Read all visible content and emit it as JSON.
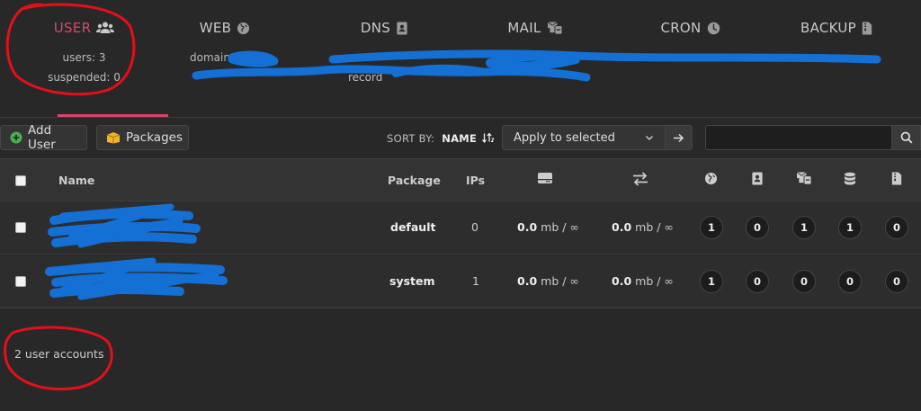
{
  "tabs": [
    {
      "id": "user",
      "label": "USER",
      "icon": "users-icon",
      "stat1": "users: 3",
      "stat2": "suspended: 0",
      "active": true
    },
    {
      "id": "web",
      "label": "WEB",
      "icon": "globe-icon",
      "stat1": "domains",
      "stat2": ""
    },
    {
      "id": "dns",
      "label": "DNS",
      "icon": "address-book-icon",
      "stat1": "",
      "stat2": "record"
    },
    {
      "id": "mail",
      "label": "MAIL",
      "icon": "mail-bulk-icon",
      "stat1": "",
      "stat2": ""
    },
    {
      "id": "cron",
      "label": "CRON",
      "icon": "clock-icon",
      "stat1": "",
      "stat2": ""
    },
    {
      "id": "backup",
      "label": "BACKUP",
      "icon": "file-archive-icon",
      "stat1": "",
      "stat2": ""
    }
  ],
  "toolbar": {
    "add_user_label": "Add User",
    "packages_label": "Packages",
    "sort_by_label": "SORT BY:",
    "sort_by_value": "NAME",
    "bulk_action_selected": "Apply to selected",
    "search_value": ""
  },
  "table": {
    "headers": {
      "name": "Name",
      "package": "Package",
      "ips": "IPs"
    },
    "header_icons": [
      "disk-icon",
      "bandwidth-icon",
      "globe-icon",
      "address-book-icon",
      "mail-icon",
      "database-icon",
      "backup-icon"
    ],
    "rows": [
      {
        "name": "",
        "package": "default",
        "ips": "0",
        "disk_value": "0.0",
        "disk_unit": "mb / ∞",
        "bw_value": "0.0",
        "bw_unit": "mb / ∞",
        "counts": [
          "1",
          "0",
          "1",
          "1",
          "0"
        ]
      },
      {
        "name": "",
        "package": "system",
        "ips": "1",
        "disk_value": "0.0",
        "disk_unit": "mb / ∞",
        "bw_value": "0.0",
        "bw_unit": "mb / ∞",
        "counts": [
          "1",
          "0",
          "0",
          "0",
          "0"
        ]
      }
    ]
  },
  "footer": {
    "summary": "2 user accounts"
  },
  "colors": {
    "accent": "#d8456b",
    "annotation_red": "#e3101a",
    "redaction_blue": "#1470d4",
    "add_icon_green": "#4cae4c",
    "packages_icon_yellow": "#f0b429"
  }
}
